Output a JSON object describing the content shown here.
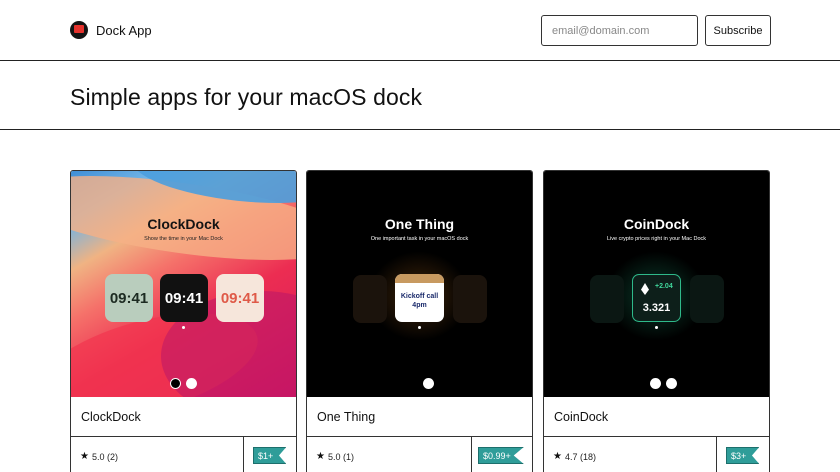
{
  "header": {
    "brand_name": "Dock App",
    "email_placeholder": "email@domain.com",
    "subscribe_label": "Subscribe"
  },
  "hero": {
    "title": "Simple apps for your macOS dock"
  },
  "cards": [
    {
      "name": "ClockDock",
      "image_title": "ClockDock",
      "image_subtitle": "Show the time in your Mac Dock",
      "clocks": [
        "09:41",
        "09:41",
        "09:41"
      ],
      "rating": "5.0",
      "reviews": "(2)",
      "price": "$1+",
      "carousel_pages": 2,
      "carousel_active": 1
    },
    {
      "name": "One Thing",
      "image_title": "One Thing",
      "image_subtitle": "One important task in your macOS dock",
      "note_line1": "Kickoff call",
      "note_line2": "4pm",
      "rating": "5.0",
      "reviews": "(1)",
      "price": "$0.99+",
      "carousel_pages": 1,
      "carousel_active": 0
    },
    {
      "name": "CoinDock",
      "image_title": "CoinDock",
      "image_subtitle": "Live crypto prices right in your Mac Dock",
      "coin_change": "+2.04",
      "coin_price": "3.321",
      "rating": "4.7",
      "reviews": "(18)",
      "price": "$3+",
      "carousel_pages": 2,
      "carousel_active": 0
    }
  ],
  "colors": {
    "price_tag": "#2f9d99",
    "coin_accent": "#40d79c",
    "brand_logo": "#e5322d"
  },
  "icons": {
    "brand": "dock-app-logo-icon",
    "rating": "star-icon",
    "coin": "ethereum-icon"
  }
}
